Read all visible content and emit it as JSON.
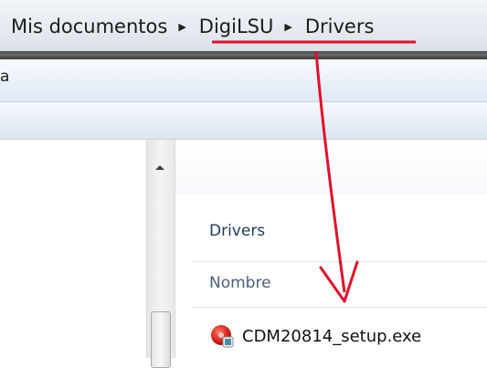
{
  "address_bar": {
    "crumbs": [
      "Mis documentos",
      "DigiLSU",
      "Drivers"
    ],
    "separator": "▶"
  },
  "toolbar": {
    "partial_text": "a"
  },
  "content": {
    "folder_title": "Drivers",
    "column_header": "Nombre",
    "files": [
      {
        "name": "CDM20814_setup.exe",
        "icon": "installer-exe-icon"
      }
    ]
  },
  "annotation": {
    "color": "#e0102a"
  }
}
